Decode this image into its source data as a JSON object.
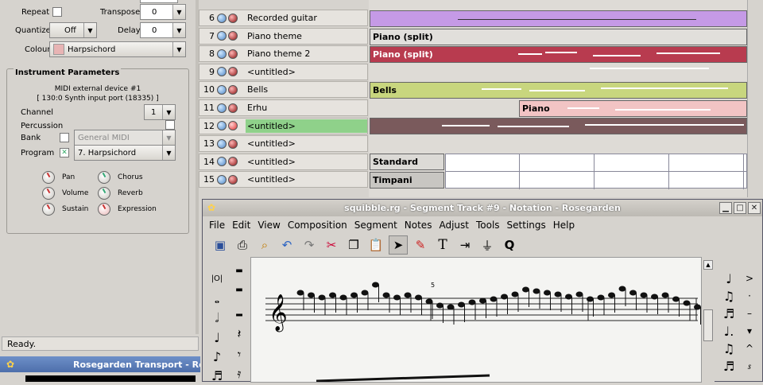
{
  "left_panel": {
    "repeat_label": "Repeat",
    "transpose_label": "Transpose",
    "transpose_value": "0",
    "quantize_label": "Quantize",
    "quantize_value": "Off",
    "delay_label": "Delay",
    "delay_value": "0",
    "colour_label": "Colour",
    "colour_value": "Harpsichord",
    "colour_swatch": "#e8b4b4",
    "instrument_title": "Instrument Parameters",
    "device_name": "MIDI external device #1",
    "device_port": "[ 130:0 Synth input port (18335) ]",
    "channel_label": "Channel",
    "channel_value": "1",
    "percussion_label": "Percussion",
    "bank_label": "Bank",
    "bank_value": "General MIDI",
    "program_label": "Program",
    "program_value": "7. Harpsichord",
    "knobs": {
      "pan": "Pan",
      "volume": "Volume",
      "sustain": "Sustain",
      "chorus": "Chorus",
      "reverb": "Reverb",
      "expression": "Expression"
    }
  },
  "status": "Ready.",
  "transport_title": "Rosegarden Transport - Rose",
  "tracks": [
    {
      "num": "6",
      "name": "Recorded guitar",
      "selected": false
    },
    {
      "num": "7",
      "name": "Piano theme",
      "selected": false
    },
    {
      "num": "8",
      "name": "Piano theme 2",
      "selected": false
    },
    {
      "num": "9",
      "name": "<untitled>",
      "selected": false
    },
    {
      "num": "10",
      "name": "Bells",
      "selected": false
    },
    {
      "num": "11",
      "name": "Erhu",
      "selected": false
    },
    {
      "num": "12",
      "name": "<untitled>",
      "selected": true
    },
    {
      "num": "13",
      "name": "<untitled>",
      "selected": false
    },
    {
      "num": "14",
      "name": "<untitled>",
      "selected": false
    },
    {
      "num": "15",
      "name": "<untitled>",
      "selected": false
    }
  ],
  "segments": {
    "piano_split_1": "Piano (split)",
    "piano_split_2": "Piano (split)",
    "bells": "Bells",
    "piano": "Piano",
    "standard": "Standard",
    "timpani": "Timpani"
  },
  "segment_colors": {
    "guitar": "#c59ae6",
    "piano_split_1": "#e1dfdb",
    "piano_split_2": "#b83b4f",
    "bells": "#c8d67e",
    "piano": "#f2c4c4",
    "erhu": "#7a5a5c",
    "standard": "#dcdad6",
    "timpani": "#c8c6c2"
  },
  "notation": {
    "title": "squibble.rg - Segment Track #9 - Notation - Rosegarden",
    "menu": [
      "File",
      "Edit",
      "View",
      "Composition",
      "Segment",
      "Notes",
      "Adjust",
      "Tools",
      "Settings",
      "Help"
    ],
    "bar_number": "5",
    "toolbar_icons": [
      "save-icon",
      "print-icon",
      "print-preview-icon",
      "undo-icon",
      "redo-icon",
      "cut-icon",
      "copy-icon",
      "paste-icon",
      "select-arrow-icon",
      "eraser-icon",
      "text-tool-icon",
      "insert-icon",
      "filter-icon",
      "quantize-q-icon"
    ]
  }
}
